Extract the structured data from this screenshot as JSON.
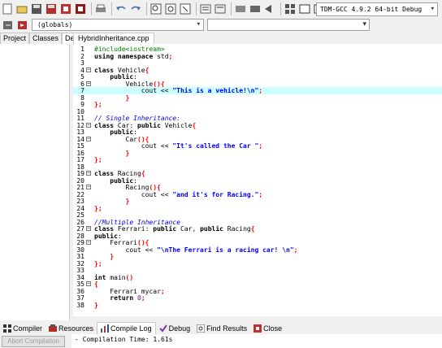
{
  "toolbar": {
    "compiler": "TDM-GCC 4.9.2 64-bit Debug"
  },
  "toolbar2": {
    "scope": "(globals)",
    "symbol": ""
  },
  "sidebar": {
    "tabs": [
      "Project",
      "Classes",
      "Debug"
    ],
    "active_tab": "Debug"
  },
  "editor": {
    "file_tab": "HybridInheritance.cpp",
    "highlight_line": 7,
    "lines": [
      "#include<iostream>",
      "using namespace std;",
      "",
      "class Vehicle{",
      "    public:",
      "        Vehicle(){",
      "            cout << \"This is a vehicle!\\n\";",
      "        }",
      "};",
      "",
      "// Single Inheritance:",
      "class Car: public Vehicle{",
      "    public:",
      "        Car(){",
      "            cout << \"It's called the Car \";",
      "        }",
      "};",
      "",
      "class Racing{",
      "    public:",
      "        Racing(){",
      "            cout << \"and it's for Racing.\";",
      "        }",
      "};",
      "",
      "//Multiple Inheritance",
      "class Ferrari: public Car, public Racing{",
      "public:",
      "    Ferrari(){",
      "        cout << \"\\nThe Ferrari is a racing car! \\n\";",
      "    }",
      "};",
      "",
      "int main()",
      "{",
      "    Ferrari mycar;",
      "    return 0;",
      "}"
    ]
  },
  "bottom": {
    "tabs": [
      {
        "label": "Compiler",
        "icon": "compiler-icon"
      },
      {
        "label": "Resources",
        "icon": "resources-icon"
      },
      {
        "label": "Compile Log",
        "icon": "compile-log-icon"
      },
      {
        "label": "Debug",
        "icon": "debug-icon"
      },
      {
        "label": "Find Results",
        "icon": "find-results-icon"
      },
      {
        "label": "Close",
        "icon": "close-icon"
      }
    ],
    "active_tab": "Compile Log",
    "abort_label": "Abort Compilation",
    "log_text": "- Compilation Time: 1.61s"
  }
}
